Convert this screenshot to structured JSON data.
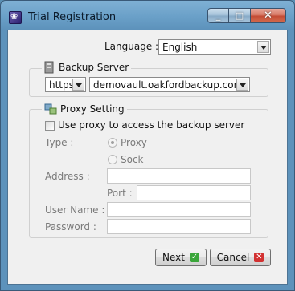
{
  "window": {
    "title": "Trial Registration",
    "minimize": "_",
    "maximize": "□",
    "close": "✕"
  },
  "language": {
    "label": "Language :",
    "value": "English"
  },
  "backup_server": {
    "heading": "Backup Server",
    "protocol": "https",
    "host": "demovault.oakfordbackup.com"
  },
  "proxy": {
    "heading": "Proxy Setting",
    "use_proxy_label": "Use proxy to access the backup server",
    "type_label": "Type :",
    "type_options": [
      "Proxy",
      "Sock"
    ],
    "address_label": "Address :",
    "address_value": "",
    "port_label": "Port :",
    "port_value": "",
    "username_label": "User Name :",
    "username_value": "",
    "password_label": "Password :",
    "password_value": ""
  },
  "buttons": {
    "next": "Next",
    "cancel": "Cancel"
  },
  "icons": {
    "app": "app-logo-icon",
    "backup": "server-icon",
    "proxy": "network-icon",
    "next": "check-icon",
    "cancel": "cancel-icon"
  }
}
